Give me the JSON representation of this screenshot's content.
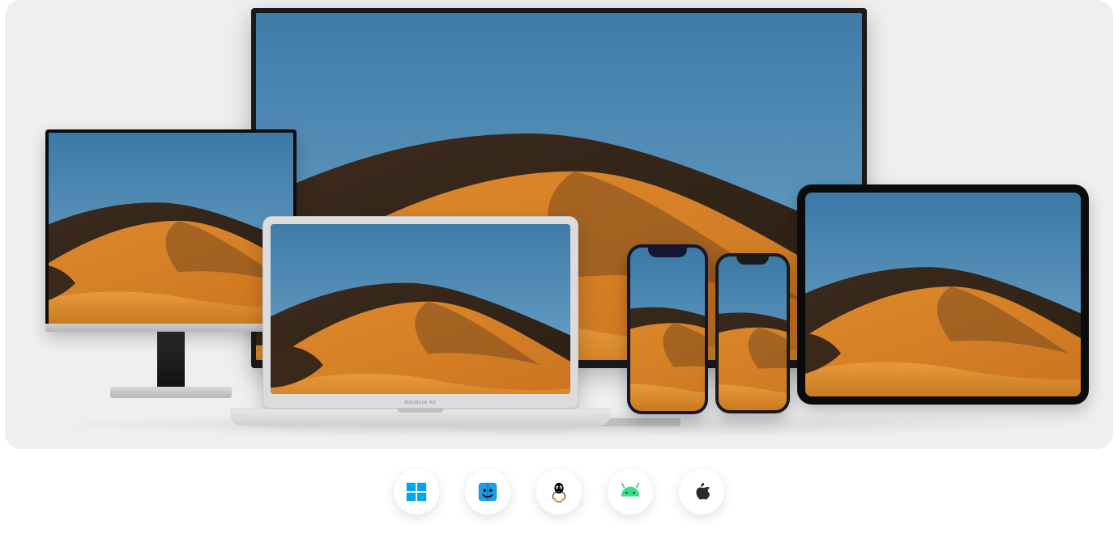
{
  "laptop_label": "MacBook Air",
  "devices": [
    {
      "name": "tv",
      "label": "Large TV"
    },
    {
      "name": "monitor",
      "label": "Desktop Monitor"
    },
    {
      "name": "tablet",
      "label": "Tablet"
    },
    {
      "name": "laptop",
      "label": "Laptop"
    },
    {
      "name": "phone1",
      "label": "Smartphone Large"
    },
    {
      "name": "phone2",
      "label": "Smartphone Small"
    }
  ],
  "platforms": [
    {
      "name": "windows",
      "label": "Windows",
      "color": "#00A4EF"
    },
    {
      "name": "macos",
      "label": "macOS",
      "color": "#1E9DE6"
    },
    {
      "name": "linux",
      "label": "Linux",
      "color": "#000000"
    },
    {
      "name": "android",
      "label": "Android",
      "color": "#3DDC84"
    },
    {
      "name": "ios",
      "label": "iOS",
      "color": "#2B2B2B"
    }
  ]
}
